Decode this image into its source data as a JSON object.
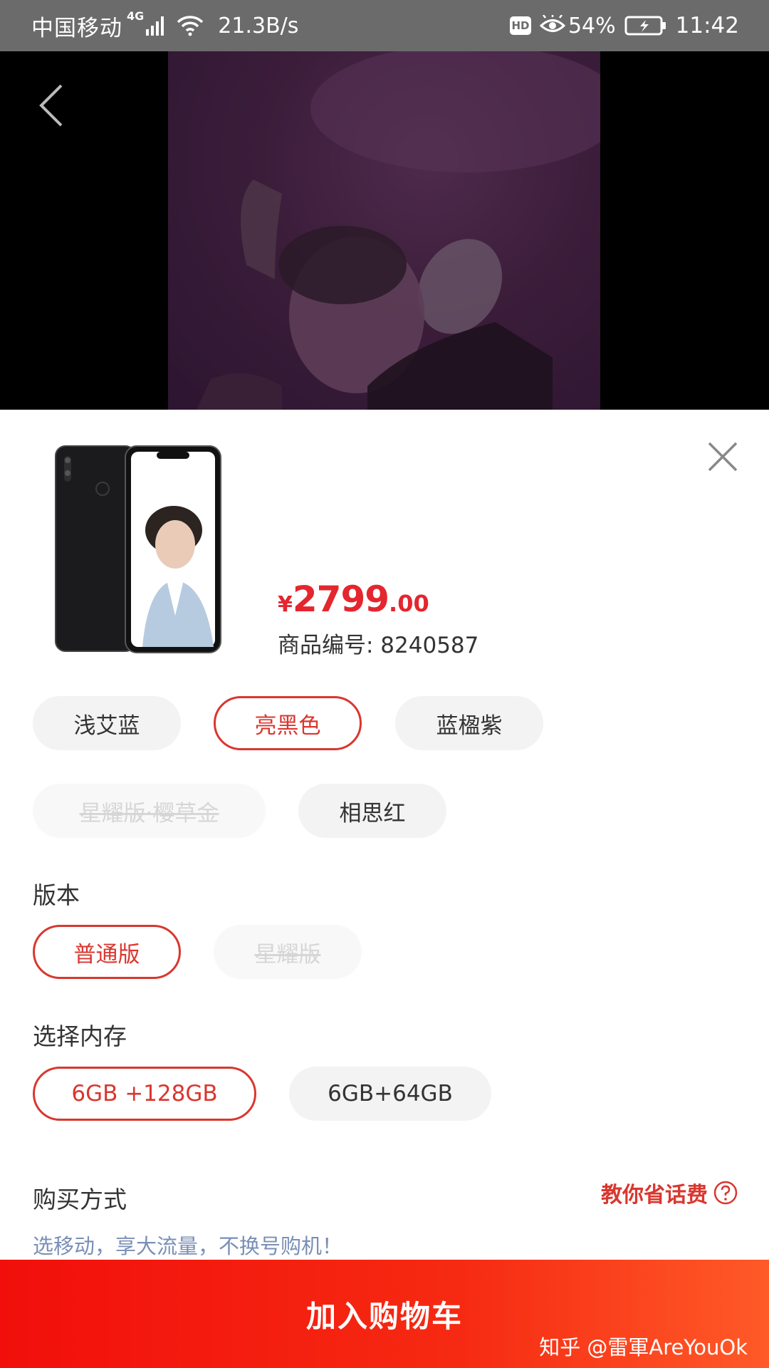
{
  "status_bar": {
    "carrier": "中国移动",
    "network": "4G",
    "speed": "21.3B/s",
    "hd": "HD",
    "battery": "54%",
    "time": "11:42"
  },
  "product": {
    "price_currency": "¥",
    "price_integer": "2799",
    "price_decimal": ".00",
    "sku_label": "商品编号: 8240587"
  },
  "colors": {
    "options": [
      {
        "label": "浅艾蓝",
        "state": "normal"
      },
      {
        "label": "亮黑色",
        "state": "selected"
      },
      {
        "label": "蓝楹紫",
        "state": "normal"
      },
      {
        "label": "星耀版·樱草金",
        "state": "disabled"
      },
      {
        "label": "相思红",
        "state": "normal"
      }
    ]
  },
  "version": {
    "title": "版本",
    "options": [
      {
        "label": "普通版",
        "state": "selected"
      },
      {
        "label": "星耀版",
        "state": "disabled"
      }
    ]
  },
  "memory": {
    "title": "选择内存",
    "options": [
      {
        "label": "6GB +128GB",
        "state": "selected"
      },
      {
        "label": "6GB+64GB",
        "state": "normal"
      }
    ]
  },
  "purchase": {
    "title": "购买方式",
    "help_link": "教你省话费",
    "promo": "选移动，享大流量，不换号购机！"
  },
  "bottom_bar": {
    "add_to_cart": "加入购物车",
    "watermark": "知乎 @雷軍AreYouOk"
  },
  "theme": {
    "accent": "#d9372f",
    "price_red": "#e4262e",
    "promo_blue": "#7a8fb6"
  }
}
